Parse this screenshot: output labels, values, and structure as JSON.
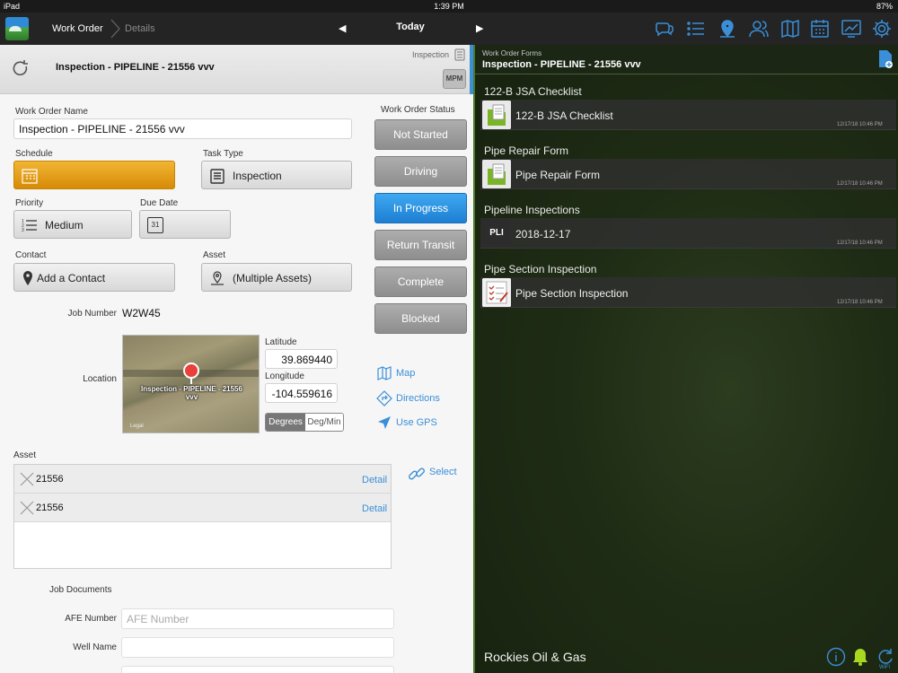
{
  "status_bar": {
    "device": "iPad",
    "time": "1:39 PM",
    "battery": "87%"
  },
  "top_nav": {
    "work_order": "Work Order",
    "details": "Details",
    "today": "Today",
    "prev": "◀",
    "next": "▶",
    "icons": [
      "chat-icon",
      "list-icon",
      "map-pin-icon",
      "contacts-icon",
      "map-icon",
      "calendar-icon",
      "chart-icon",
      "settings-icon"
    ]
  },
  "colors": {
    "accent": "#3a8fd8",
    "schedule": "#e8a21c",
    "active_status": "#2b8fe0",
    "status_gray": "#9e9e9e"
  },
  "left": {
    "title": "Inspection - PIPELINE - 21556 vvv",
    "inspection_tag": "Inspection",
    "mpm": "MPM",
    "work_order_name_label": "Work Order Name",
    "work_order_name_value": "Inspection - PIPELINE - 21556 vvv",
    "schedule_label": "Schedule",
    "task_type_label": "Task Type",
    "task_type_value": "Inspection",
    "priority_label": "Priority",
    "priority_value": "Medium",
    "due_date_label": "Due Date",
    "due_date_icon_text": "31",
    "contact_label": "Contact",
    "contact_value": "Add a Contact",
    "asset_label": "Asset",
    "asset_value": "(Multiple Assets)",
    "job_number_label": "Job Number",
    "job_number_value": "W2W45",
    "location_label": "Location",
    "map_label": "Inspection - PIPELINE - 21556 vvv",
    "map_legal": "Legal",
    "latitude_label": "Latitude",
    "latitude_value": "39.869440",
    "longitude_label": "Longitude",
    "longitude_value": "-104.559616",
    "degrees": "Degrees",
    "deg_min": "Deg/Min",
    "map_link": "Map",
    "directions_link": "Directions",
    "use_gps_link": "Use GPS",
    "status_label": "Work Order Status",
    "statuses": [
      "Not Started",
      "Driving",
      "In Progress",
      "Return Transit",
      "Complete",
      "Blocked"
    ],
    "active_status": "In Progress",
    "asset_list_label": "Asset",
    "select_link": "Select",
    "assets": [
      {
        "value": "21556",
        "detail": "Detail"
      },
      {
        "value": "21556",
        "detail": "Detail"
      }
    ],
    "job_documents_label": "Job Documents",
    "afe_label": "AFE Number",
    "afe_placeholder": "AFE Number",
    "well_name_label": "Well Name"
  },
  "right": {
    "subtitle": "Work Order Forms",
    "title": "Inspection - PIPELINE - 21556 vvv",
    "sections": [
      {
        "header": "122-B JSA Checklist",
        "form": "122-B JSA Checklist",
        "date": "12/17/18 10:46 PM",
        "thumb": "green-form-icon"
      },
      {
        "header": "Pipe Repair Form",
        "form": "Pipe Repair Form",
        "date": "12/17/18 10:46 PM",
        "thumb": "green-form-icon"
      },
      {
        "header": "Pipeline Inspections",
        "form": "2018-12-17",
        "date": "12/17/18 10:46 PM",
        "thumb": "PLI"
      },
      {
        "header": "Pipe Section Inspection",
        "form": "Pipe Section Inspection",
        "date": "12/17/18 10:46 PM",
        "thumb": "checklist-icon"
      }
    ],
    "company": "Rockies Oil & Gas",
    "wifi": "WiFi"
  }
}
